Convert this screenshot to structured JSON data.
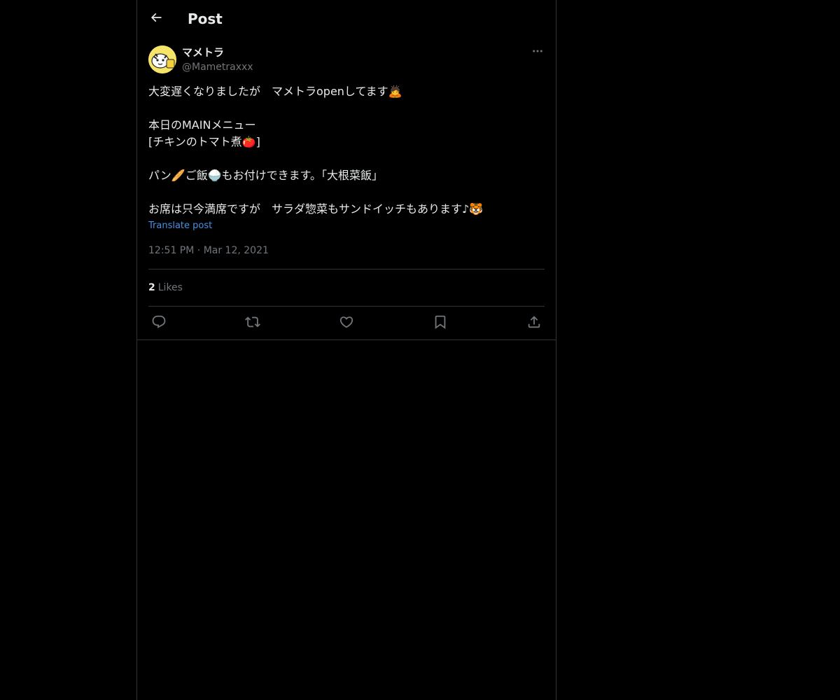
{
  "header": {
    "title": "Post"
  },
  "author": {
    "display_name": "マメトラ",
    "handle": "@Mametraxxx"
  },
  "post": {
    "lines": [
      "大変遅くなりましたが　マメトラopenしてます🙇",
      "",
      "本日のMAINメニュー",
      "[チキンのトマト煮🍅]",
      "",
      "パン🥖ご飯🍚もお付けできます。「大根菜飯」",
      "",
      "お席は只今満席ですが　サラダ惣菜もサンドイッチもあります♪🐯"
    ],
    "translate_label": "Translate post",
    "time": "12:51 PM",
    "separator": "·",
    "date": "Mar 12, 2021"
  },
  "stats": {
    "likes_count": "2",
    "likes_label": "Likes"
  },
  "icons": {
    "back": "arrow-left-icon",
    "more": "more-horizontal-icon",
    "reply": "reply-icon",
    "repost": "repost-icon",
    "like": "heart-icon",
    "bookmark": "bookmark-icon",
    "share": "share-icon"
  },
  "colors": {
    "background": "#000000",
    "text": "#e7e9ea",
    "muted": "#71767b",
    "link": "#4a90e2",
    "border": "#2f3336",
    "avatar": "#f4e04d"
  }
}
